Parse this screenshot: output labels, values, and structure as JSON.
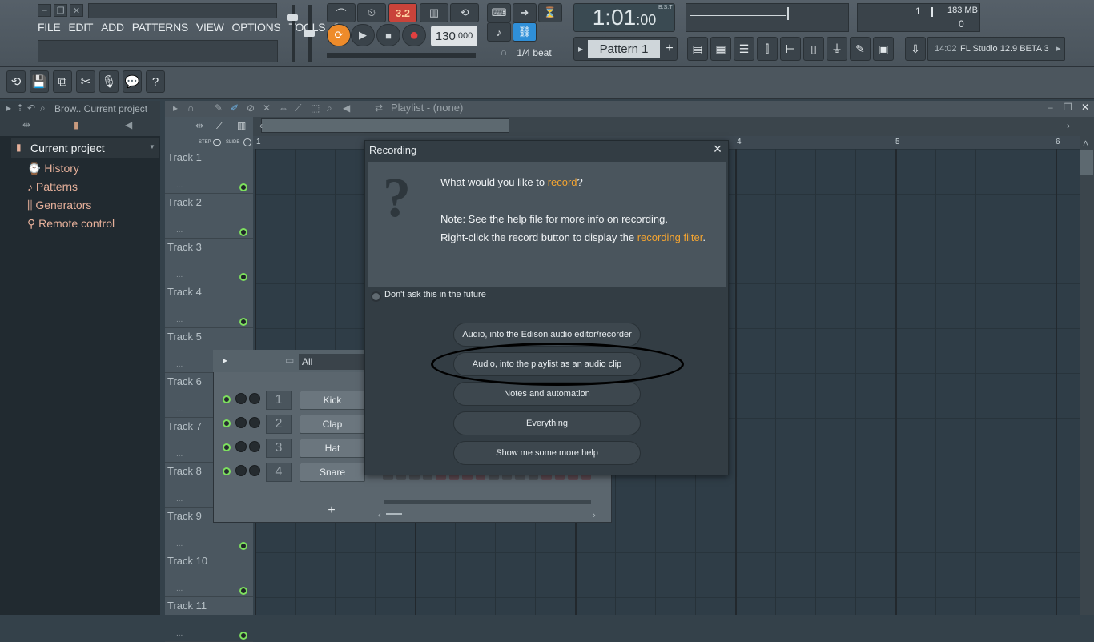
{
  "window": {
    "menu": [
      "FILE",
      "EDIT",
      "ADD",
      "PATTERNS",
      "VIEW",
      "OPTIONS",
      "TOOLS",
      "?"
    ]
  },
  "transport": {
    "time": "1:01",
    "time_sub": ":00",
    "time_label": "B:S:T",
    "tempo": "130",
    "tempo_frac": ".000",
    "pattern_number_display": "3.2",
    "snap": "1/4 beat",
    "pattern": "Pattern 1",
    "pattern_plus": "+"
  },
  "monitor": {
    "memory": "183 MB",
    "value1": "1",
    "value2": "0"
  },
  "hint_panel": {
    "version_time": "14:02",
    "version": "FL Studio 12.9 BETA 3"
  },
  "browser": {
    "header": "Brow.. Current project",
    "root": "Current project",
    "items": [
      {
        "label": "History",
        "icon": "history-icon"
      },
      {
        "label": "Patterns",
        "icon": "note-icon"
      },
      {
        "label": "Generators",
        "icon": "piano-icon"
      },
      {
        "label": "Remote control",
        "icon": "remote-icon"
      }
    ]
  },
  "playlist": {
    "title": "Playlist - (none)",
    "step": "STEP",
    "slide": "SLIDE",
    "ruler": [
      "1",
      "4",
      "5",
      "6"
    ],
    "tracks": [
      "Track 1",
      "Track 2",
      "Track 3",
      "Track 4",
      "Track 5",
      "Track 6",
      "Track 7",
      "Track 8",
      "Track 9",
      "Track 10",
      "Track 11"
    ],
    "track_dots": "..."
  },
  "channel_rack": {
    "filter": "All",
    "channels": [
      {
        "num": "1",
        "name": "Kick"
      },
      {
        "num": "2",
        "name": "Clap"
      },
      {
        "num": "3",
        "name": "Hat"
      },
      {
        "num": "4",
        "name": "Snare"
      }
    ],
    "add": "+"
  },
  "dialog": {
    "title": "Recording",
    "question_prefix": "What would you like to ",
    "question_link": "record",
    "question_suffix": "?",
    "note1": "Note: See the help file for more info on recording.",
    "note2_prefix": "Right-click the record button to display the ",
    "note2_link": "recording filter",
    "note2_suffix": ".",
    "dont_ask": "Don't ask this in the future",
    "options": [
      "Audio, into the Edison audio editor/recorder",
      "Audio, into the playlist as an audio clip",
      "Notes and automation",
      "Everything",
      "Show me some more help"
    ]
  },
  "colors": {
    "accent_orange": "#f3a431",
    "led_green": "#7de05e",
    "record_red": "#e24040"
  }
}
